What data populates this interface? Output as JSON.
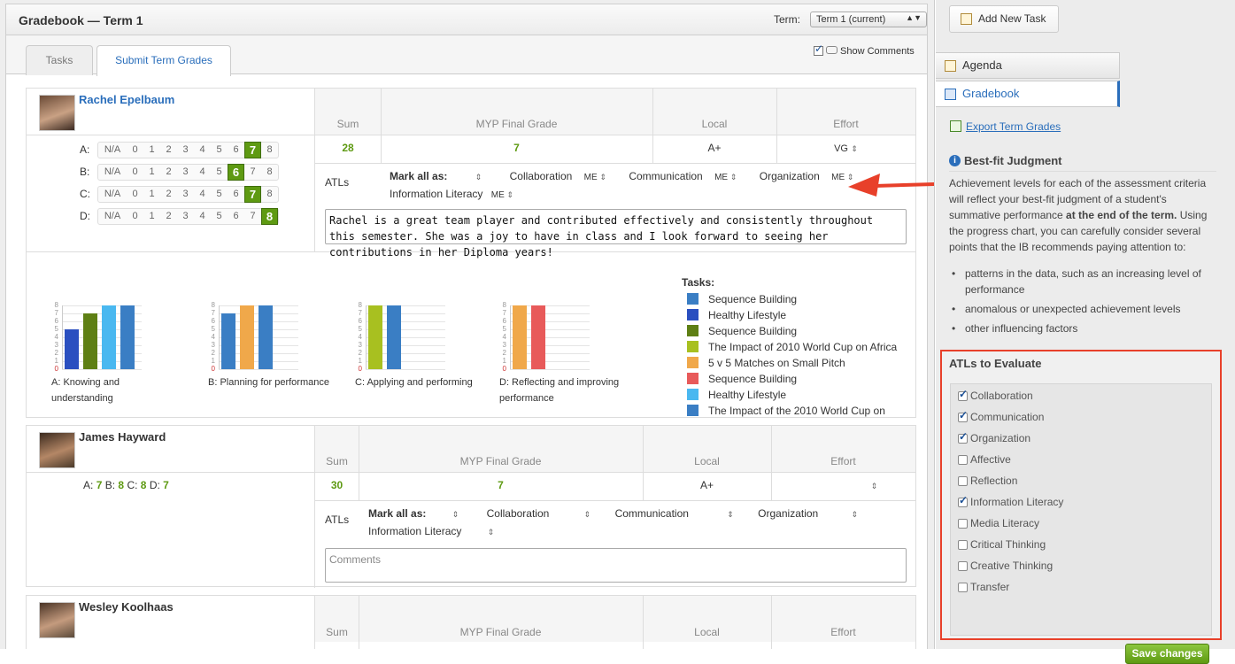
{
  "header": {
    "title": "Gradebook — Term 1",
    "term_label": "Term:",
    "term_value": "Term 1 (current)"
  },
  "tabs": [
    {
      "label": "Tasks"
    },
    {
      "label": "Submit Term Grades"
    }
  ],
  "show_comments": {
    "label": "Show Comments",
    "checked": true
  },
  "columns": {
    "sum": "Sum",
    "myp": "MYP Final Grade",
    "local": "Local",
    "effort": "Effort"
  },
  "students": [
    {
      "name": "Rachel Epelbaum",
      "criteria": [
        {
          "label": "A:",
          "na": "N/A",
          "scale": [
            "0",
            "1",
            "2",
            "3",
            "4",
            "5",
            "6",
            "7",
            "8"
          ],
          "selected": "7"
        },
        {
          "label": "B:",
          "na": "N/A",
          "scale": [
            "0",
            "1",
            "2",
            "3",
            "4",
            "5",
            "6",
            "7",
            "8"
          ],
          "selected": "6"
        },
        {
          "label": "C:",
          "na": "N/A",
          "scale": [
            "0",
            "1",
            "2",
            "3",
            "4",
            "5",
            "6",
            "7",
            "8"
          ],
          "selected": "7"
        },
        {
          "label": "D:",
          "na": "N/A",
          "scale": [
            "0",
            "1",
            "2",
            "3",
            "4",
            "5",
            "6",
            "7",
            "8"
          ],
          "selected": "8"
        }
      ],
      "sum": "28",
      "myp": "7",
      "local": "A+",
      "effort": "VG",
      "atls_label": "ATLs",
      "mark_all": "Mark all as:",
      "atls": [
        {
          "name": "Collaboration",
          "value": "ME"
        },
        {
          "name": "Communication",
          "value": "ME"
        },
        {
          "name": "Organization",
          "value": "ME"
        },
        {
          "name": "Information Literacy",
          "value": "ME"
        }
      ],
      "comment": "Rachel is a great team player and contributed effectively and consistently throughout this semester. She was a joy to have in class and I look forward to seeing her contributions in her Diploma years!"
    },
    {
      "name": "James Hayward",
      "summary": [
        {
          "k": "A:",
          "v": "7"
        },
        {
          "k": "B:",
          "v": "8"
        },
        {
          "k": "C:",
          "v": "8"
        },
        {
          "k": "D:",
          "v": "7"
        }
      ],
      "sum": "30",
      "myp": "7",
      "local": "A+",
      "effort": "",
      "atls_label": "ATLs",
      "mark_all": "Mark all as:",
      "atls": [
        {
          "name": "Collaboration",
          "value": ""
        },
        {
          "name": "Communication",
          "value": ""
        },
        {
          "name": "Organization",
          "value": ""
        },
        {
          "name": "Information Literacy",
          "value": ""
        }
      ],
      "comment_placeholder": "Comments"
    },
    {
      "name": "Wesley Koolhaas"
    }
  ],
  "chart_data": [
    {
      "type": "bar",
      "xlabel": "A: Knowing and understanding",
      "ylim": [
        0,
        8
      ],
      "yticks": [
        "0",
        "1",
        "2",
        "3",
        "4",
        "5",
        "6",
        "7",
        "8"
      ],
      "values": [
        5,
        7,
        8,
        8
      ],
      "colors": [
        "#2a4fc0",
        "#5e7f14",
        "#4ab8f0",
        "#3a7ec4"
      ]
    },
    {
      "type": "bar",
      "xlabel": "B: Planning for performance",
      "ylim": [
        0,
        8
      ],
      "yticks": [
        "0",
        "1",
        "2",
        "3",
        "4",
        "5",
        "6",
        "7",
        "8"
      ],
      "values": [
        7,
        8,
        8
      ],
      "colors": [
        "#3a7ec4",
        "#f0a84a",
        "#3a7ec4"
      ]
    },
    {
      "type": "bar",
      "xlabel": "C: Applying and performing",
      "ylim": [
        0,
        8
      ],
      "yticks": [
        "0",
        "1",
        "2",
        "3",
        "4",
        "5",
        "6",
        "7",
        "8"
      ],
      "values": [
        8,
        8
      ],
      "colors": [
        "#a8c020",
        "#3a7ec4"
      ]
    },
    {
      "type": "bar",
      "xlabel": "D: Reflecting and improving performance",
      "ylim": [
        0,
        8
      ],
      "yticks": [
        "0",
        "1",
        "2",
        "3",
        "4",
        "5",
        "6",
        "7",
        "8"
      ],
      "values": [
        8,
        8
      ],
      "colors": [
        "#f0a84a",
        "#e85a5a"
      ]
    }
  ],
  "legend": {
    "title": "Tasks:",
    "items": [
      {
        "label": "Sequence Building",
        "color": "#3a7ec4"
      },
      {
        "label": "Healthy Lifestyle",
        "color": "#2a4fc0"
      },
      {
        "label": "Sequence Building",
        "color": "#5e7f14"
      },
      {
        "label": "The Impact of 2010 World Cup on Africa",
        "color": "#a8c020"
      },
      {
        "label": "5 v 5 Matches on Small Pitch",
        "color": "#f0a84a"
      },
      {
        "label": "Sequence Building",
        "color": "#e85a5a"
      },
      {
        "label": "Healthy Lifestyle",
        "color": "#4ab8f0"
      },
      {
        "label": "The Impact of the 2010 World Cup on",
        "color": "#3a7ec4"
      }
    ]
  },
  "sidebar": {
    "add_task": "Add New Task",
    "nav": [
      {
        "label": "Agenda"
      },
      {
        "label": "Gradebook"
      }
    ],
    "export": "Export Term Grades",
    "bfj_title": "Best-fit Judgment",
    "bfj_text_1": "Achievement levels for each of the assessment criteria will reflect your best-fit judgment of a student's summative performance ",
    "bfj_text_bold": "at the end of the term.",
    "bfj_text_2": " Using the progress chart, you can carefully consider several points that the IB recommends paying attention to:",
    "bfj_points": [
      "patterns in the data, such as an increasing level of performance",
      "anomalous or unexpected achievement levels",
      "other influencing factors"
    ],
    "atl_title": "ATLs to Evaluate",
    "atl_items": [
      {
        "label": "Collaboration",
        "checked": true
      },
      {
        "label": "Communication",
        "checked": true
      },
      {
        "label": "Organization",
        "checked": true
      },
      {
        "label": "Affective",
        "checked": false
      },
      {
        "label": "Reflection",
        "checked": false
      },
      {
        "label": "Information Literacy",
        "checked": true
      },
      {
        "label": "Media Literacy",
        "checked": false
      },
      {
        "label": "Critical Thinking",
        "checked": false
      },
      {
        "label": "Creative Thinking",
        "checked": false
      },
      {
        "label": "Transfer",
        "checked": false
      }
    ],
    "save": "Save changes"
  }
}
